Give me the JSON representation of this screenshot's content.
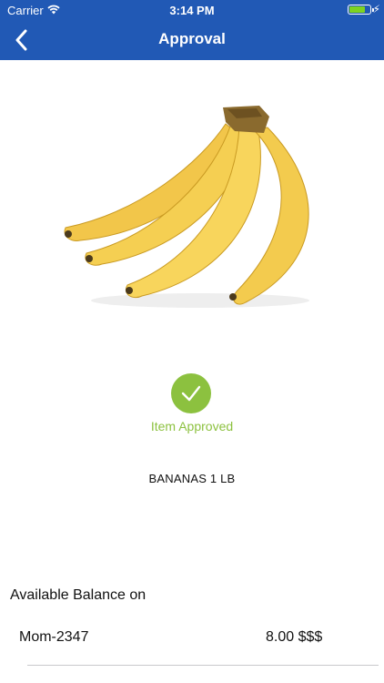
{
  "status_bar": {
    "carrier": "Carrier",
    "time": "3:14 PM",
    "battery_color": "#7ed321"
  },
  "nav": {
    "title": "Approval",
    "back_icon": "chevron-left-icon",
    "background_color": "#2159b5"
  },
  "product": {
    "image": "bananas-photo",
    "status": "Item Approved",
    "status_icon": "check-icon",
    "status_color": "#8cc13f",
    "name": "BANANAS 1 LB"
  },
  "balance": {
    "heading": "Available Balance on",
    "accounts": [
      {
        "name": "Mom-2347",
        "amount": "8.00 $$$"
      }
    ]
  }
}
